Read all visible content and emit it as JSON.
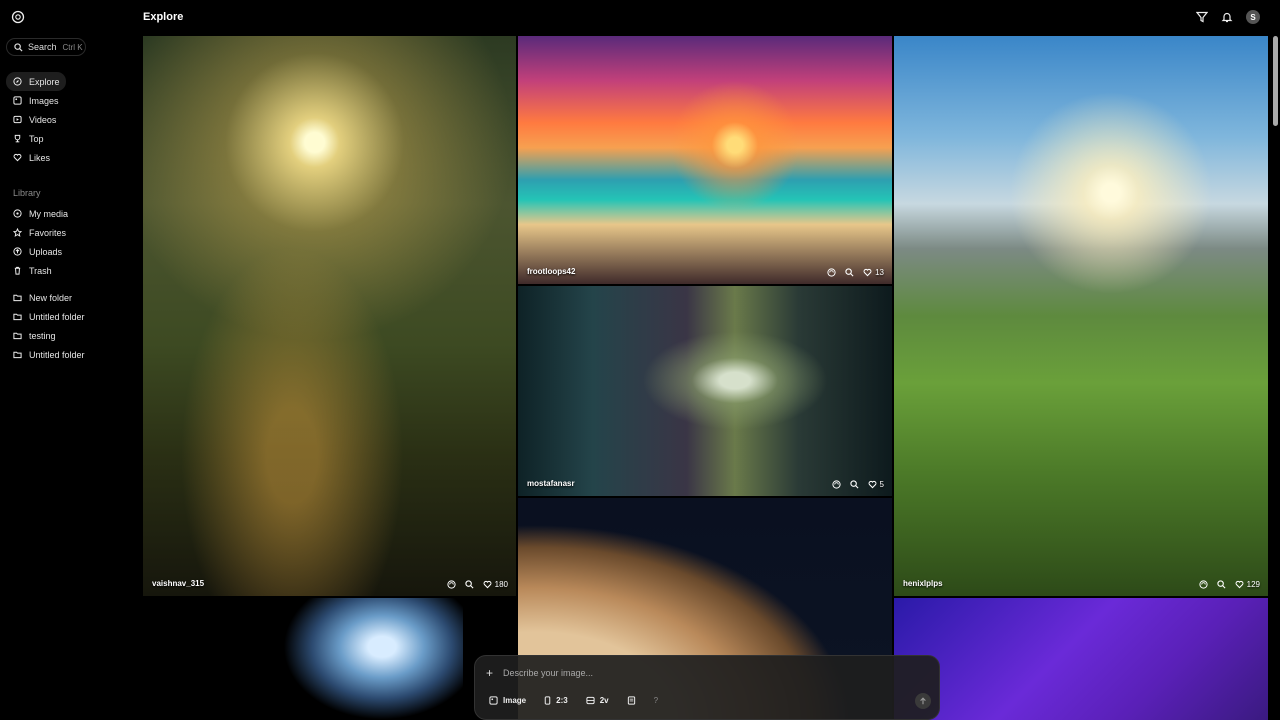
{
  "header": {
    "title": "Explore",
    "avatar_initial": "S"
  },
  "search": {
    "label": "Search",
    "shortcut": "Ctrl K"
  },
  "nav": [
    {
      "label": "Explore",
      "icon": "compass-icon",
      "active": true
    },
    {
      "label": "Images",
      "icon": "image-icon"
    },
    {
      "label": "Videos",
      "icon": "video-icon"
    },
    {
      "label": "Top",
      "icon": "trophy-icon"
    },
    {
      "label": "Likes",
      "icon": "heart-icon"
    }
  ],
  "library": {
    "label": "Library",
    "items": [
      {
        "label": "My media",
        "icon": "media-icon"
      },
      {
        "label": "Favorites",
        "icon": "star-icon"
      },
      {
        "label": "Uploads",
        "icon": "upload-icon"
      },
      {
        "label": "Trash",
        "icon": "trash-icon"
      }
    ],
    "folders": [
      {
        "label": "New folder"
      },
      {
        "label": "Untitled folder"
      },
      {
        "label": "testing"
      },
      {
        "label": "Untitled folder"
      }
    ]
  },
  "gallery": [
    {
      "username": "vaishnav_315",
      "likes": "180"
    },
    {
      "username": "frootloops42",
      "likes": "13"
    },
    {
      "username": "mostafanasr",
      "likes": "5"
    },
    {
      "username": "henixlplps",
      "likes": "129"
    }
  ],
  "prompt": {
    "placeholder": "Describe your image...",
    "mode": "Image",
    "ratio": "2:3",
    "variants": "2v",
    "help": "?"
  }
}
